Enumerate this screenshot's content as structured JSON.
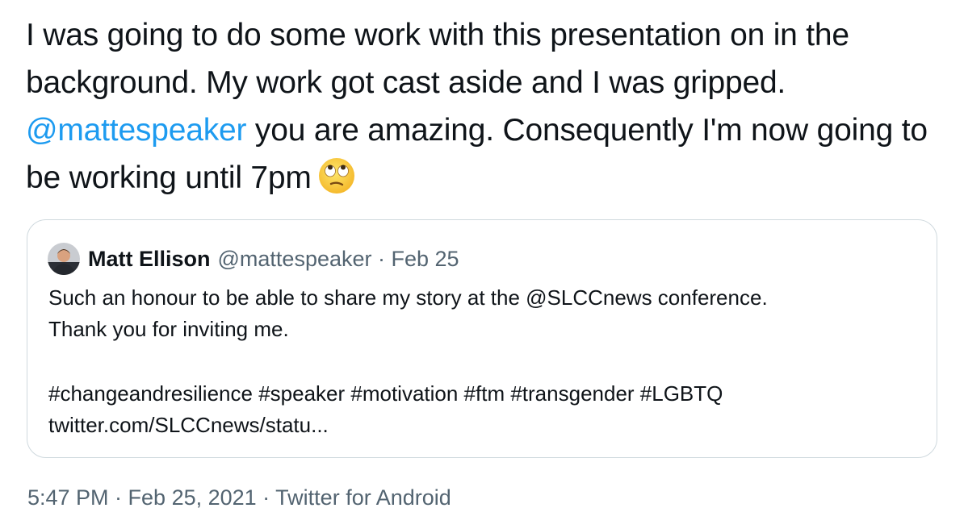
{
  "tweet": {
    "text_before_mention": "I was going to do some work with this presentation on in the background. My work got cast aside and I was gripped. ",
    "mention": "@mattespeaker",
    "text_after_mention": " you are amazing. Consequently I'm now going to be working until 7pm",
    "emoji": "face-with-rolling-eyes"
  },
  "quoted_tweet": {
    "author_name": "Matt Ellison",
    "author_meta": "@mattespeaker · Feb 25",
    "body_line_1": "Such an honour to be able to share my story at the @SLCCnews conference.",
    "body_line_2": "Thank you for inviting me.",
    "hashtags": "#changeandresilience #speaker #motivation #ftm #transgender #LGBTQ",
    "link": "twitter.com/SLCCnews/statu..."
  },
  "footer": {
    "timestamp_source": "5:47 PM · Feb 25, 2021 · Twitter for Android"
  },
  "colors": {
    "text": "#0f1419",
    "mention": "#1d9bf0",
    "muted": "#536471",
    "border": "#cfd9de"
  }
}
